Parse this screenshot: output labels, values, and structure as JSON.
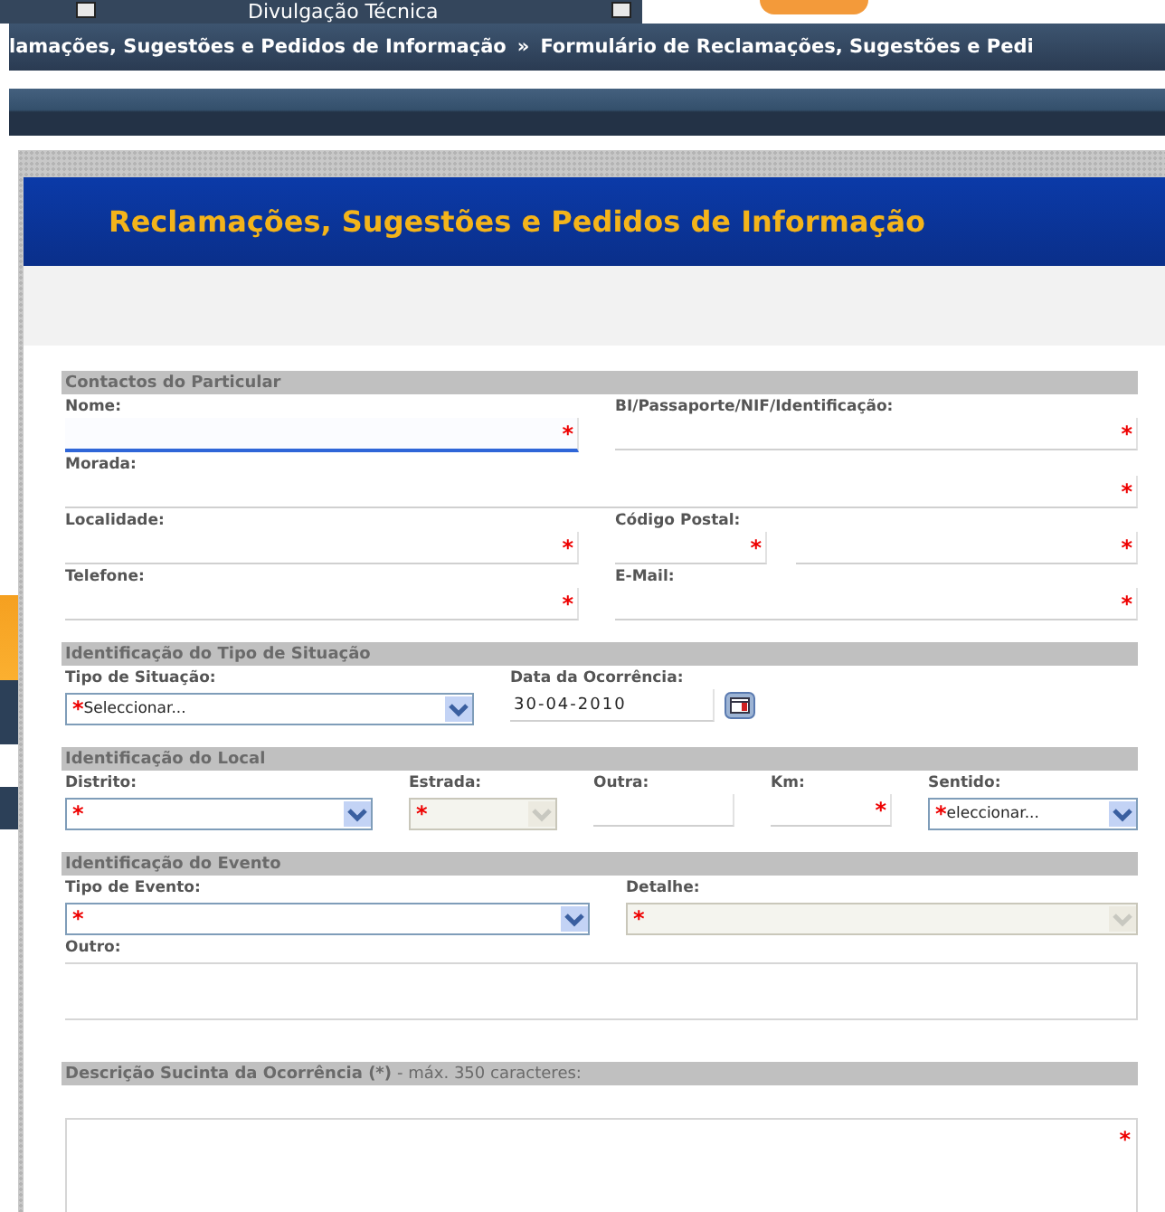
{
  "nav": {
    "menu_item": "Divulgação Técnica"
  },
  "breadcrumb": {
    "items": [
      "lamações, Sugestões e Pedidos de Informação",
      "Formulário de Reclamações, Sugestões e Pedi"
    ],
    "separator": "»"
  },
  "dialog": {
    "title": "Reclamações, Sugestões e Pedidos de Informação"
  },
  "sections": [
    {
      "title": "Contactos do Particular",
      "rows": [
        [
          {
            "kind": "text",
            "label": "Nome:",
            "marks": [
              "*"
            ],
            "focused": true
          },
          {
            "kind": "text",
            "label": "BI/Passaporte/NIF/Identificação:",
            "marks": [
              "*"
            ],
            "focused": false
          }
        ],
        [
          {
            "kind": "text",
            "label": "Morada:",
            "marks": [
              "*"
            ],
            "focused": false
          }
        ],
        [
          {
            "kind": "text",
            "label": "Localidade:",
            "marks": [
              "*"
            ],
            "focused": false
          },
          {
            "kind": "text",
            "label": "Código Postal:",
            "marks": [
              "*",
              "*"
            ]
          }
        ],
        [
          {
            "kind": "text",
            "label": "Telefone:",
            "marks": [
              "*"
            ],
            "focused": false
          },
          {
            "kind": "text",
            "label": "E-Mail:",
            "marks": [
              "*"
            ],
            "focused": false
          }
        ]
      ]
    },
    {
      "title": "Identificação do Tipo de Situação",
      "rows": [
        [
          {
            "kind": "select",
            "label": "Tipo de Situação:",
            "marks": [
              "*"
            ],
            "value": "Seleccionar...",
            "disabled": false
          },
          {
            "kind": "date",
            "label": "Data da Ocorrência:",
            "value": "30-04-2010"
          }
        ]
      ]
    },
    {
      "title": "Identificação do Local",
      "rows": [
        [
          {
            "kind": "select",
            "label": "Distrito:",
            "marks": [
              "*"
            ],
            "disabled": false
          },
          {
            "kind": "select",
            "label": "Estrada:",
            "marks": [
              "*"
            ],
            "disabled": true
          },
          {
            "kind": "text",
            "label": "Outra:",
            "focused": false
          },
          {
            "kind": "text",
            "label": "Km:",
            "marks": [
              "*"
            ],
            "focused": false
          },
          {
            "kind": "select",
            "label": "Sentido:",
            "marks": [
              "*"
            ],
            "value": "eleccionar...",
            "disabled": false
          }
        ]
      ]
    },
    {
      "title": "Identificação do Evento",
      "rows": [
        [
          {
            "kind": "select",
            "label": "Tipo de Evento:",
            "marks": [
              "*"
            ],
            "disabled": false
          },
          {
            "kind": "select",
            "label": "Detalhe:",
            "marks": [
              "*"
            ],
            "disabled": true
          }
        ],
        [
          {
            "kind": "area",
            "label": "Outro:"
          }
        ]
      ]
    },
    {
      "title": "Descrição Sucinta da Ocorrência (*)",
      "note": "- máx. 350 caracteres:",
      "rows": [
        [
          {
            "kind": "bigarea",
            "marks": [
              "*"
            ]
          }
        ]
      ]
    }
  ]
}
